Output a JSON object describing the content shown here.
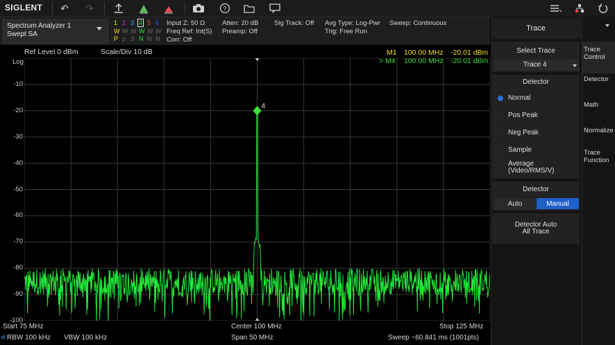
{
  "toolbar": {
    "logo": "SIGLENT",
    "icons": [
      "undo-icon",
      "redo-icon",
      "marker-up-icon",
      "peak-search-icon",
      "marker-down-icon",
      "camera-icon",
      "help-icon",
      "folder-icon",
      "message-icon",
      "menu-list-icon",
      "network-icon",
      "power-icon"
    ]
  },
  "analyzer": {
    "name": "Spectrum Analyzer 1",
    "mode": "Swept SA"
  },
  "traces": {
    "numbers": [
      "1",
      "2",
      "3",
      "4",
      "5",
      "6"
    ],
    "colors": [
      "#f0e020",
      "#d040d0",
      "#40b0ff",
      "#20e040",
      "#ff4040",
      "#3050ff"
    ],
    "row1": [
      "W",
      "W",
      "W",
      "W",
      "W",
      "W"
    ],
    "row2": [
      "P",
      "p",
      "S",
      "N",
      "N",
      "N"
    ]
  },
  "info": {
    "input_z": "Input Z: 50 Ω",
    "freq_ref": "Freq Ref: Int(S)",
    "corr": "Corr: Off",
    "atten": "Atten: 20 dB",
    "preamp": "Preamp: Off",
    "sig_track": "Sig Track: Off",
    "avg_type": "Avg Type: Log-Pwr",
    "trig": "Trig: Free Run",
    "sweep": "Sweep: Continuous"
  },
  "plot": {
    "ref_level": "Ref Level  0 dBm",
    "scale": "Scale/Div  10 dB",
    "scale_type": "Log",
    "y_labels": [
      "-10",
      "-20",
      "-30",
      "-40",
      "-50",
      "-60",
      "-70",
      "-80",
      "-90",
      "-100"
    ],
    "marker1": {
      "label": "M1",
      "freq": "100.00 MHz",
      "level": "-20.01 dBm"
    },
    "marker4": {
      "label": "> M4",
      "freq": "100.00 MHz",
      "level": "-20.01 dBm"
    },
    "marker_tag": "4"
  },
  "chart_data": {
    "type": "line",
    "x_range_mhz": [
      75,
      125
    ],
    "ylim": [
      -100,
      0
    ],
    "noise_floor_dbm": -85,
    "peak": {
      "x": 100.0,
      "y": -20.01
    },
    "grid": true
  },
  "footer": {
    "start": "Start  75 MHz",
    "center": "Center  100 MHz",
    "stop": "Stop  125 MHz",
    "rbw": "RBW  100 kHz",
    "vbw": "VBW  100 kHz",
    "span": "Span  50 MHz",
    "sweep": "Sweep  ~60.841 ms (1001pts)"
  },
  "panel": {
    "title": "Trace",
    "select_trace_title": "Select Trace",
    "select_trace_value": "Trace 4",
    "detector_title": "Detector",
    "detectors": [
      "Normal",
      "Pos Peak",
      "Neg Peak",
      "Sample",
      "Average",
      "(Video/RMS/V)"
    ],
    "detector_mode_title": "Detector",
    "auto_label": "Auto",
    "manual_label": "Manual",
    "detector_auto_line1": "Detector Auto",
    "detector_auto_line2": "All Trace"
  },
  "side_tabs": {
    "trace_control_1": "Trace",
    "trace_control_2": "Control",
    "detector": "Detector",
    "math": "Math",
    "normalize": "Normalize",
    "trace_function_1": "Trace",
    "trace_function_2": "Function"
  }
}
